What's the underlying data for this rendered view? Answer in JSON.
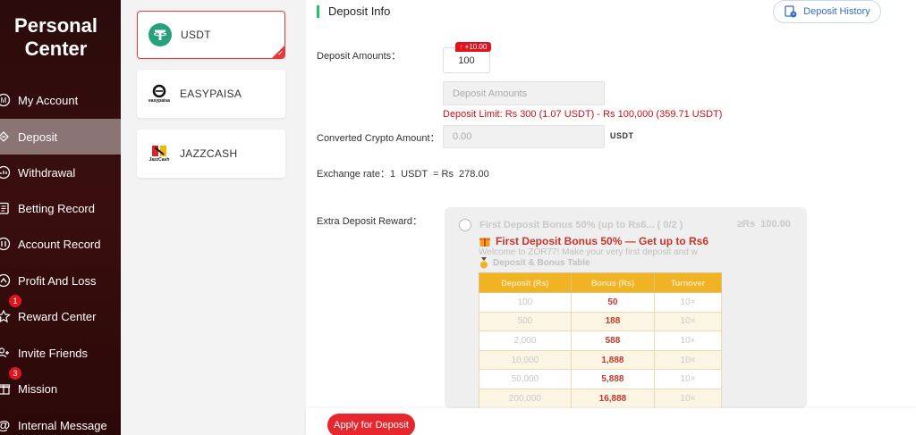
{
  "sidebar": {
    "title_line1": "Personal",
    "title_line2": "Center",
    "items": [
      {
        "label": "My Account",
        "icon": "account-icon"
      },
      {
        "label": "Deposit",
        "icon": "deposit-icon",
        "active": true
      },
      {
        "label": "Withdrawal",
        "icon": "withdrawal-icon"
      },
      {
        "label": "Betting Record",
        "icon": "betting-record-icon"
      },
      {
        "label": "Account Record",
        "icon": "account-record-icon"
      },
      {
        "label": "Profit And Loss",
        "icon": "profit-loss-icon"
      },
      {
        "label": "Reward Center",
        "icon": "reward-icon",
        "badge": "1"
      },
      {
        "label": "Invite Friends",
        "icon": "invite-icon"
      },
      {
        "label": "Mission",
        "icon": "gift-icon",
        "badge": "3"
      },
      {
        "label": "Internal Message",
        "icon": "at-icon"
      }
    ]
  },
  "methods": [
    {
      "label": "USDT",
      "selected": true
    },
    {
      "label": "EASYPAISA",
      "logo_text": "easypaisa"
    },
    {
      "label": "JAZZCASH",
      "logo_text": "JazzCash"
    }
  ],
  "deposit": {
    "section_title": "Deposit Info",
    "history_label": "Deposit History",
    "amounts_label": "Deposit Amounts：",
    "amount_value": "100",
    "amount_bonus_tag": "+10.00",
    "amount_bonus_arrow": "↑",
    "amount_placeholder": "Deposit Amounts",
    "limit_text": "Deposit Limit:  Rs  300 (1.07 USDT) - Rs  100,000 (359.71 USDT)",
    "crypto_label": "Converted Crypto Amount：",
    "crypto_value": "0.00",
    "crypto_unit": "USDT",
    "rate_label": "Exchange rate：",
    "rate_value": "1  USDT  = Rs  278.00",
    "reward_label": "Extra Deposit Reward："
  },
  "reward": {
    "heading": "First Deposit Bonus 50% (up to Rs6...  ( 0/2 )",
    "min": "≥Rs  100.00",
    "bonus_title": "First Deposit Bonus 50% — Get up to Rs6",
    "welcome": "Welcome to ZOR77! Make your very first deposit and w",
    "table_title": "Deposit & Bonus Table",
    "columns": [
      "Deposit (Rs)",
      "Bonus (Rs)",
      "Turnover"
    ],
    "rows": [
      [
        "100",
        "50",
        "10×"
      ],
      [
        "500",
        "188",
        "10×"
      ],
      [
        "2,000",
        "588",
        "10×"
      ],
      [
        "10,000",
        "1,888",
        "10×"
      ],
      [
        "50,000",
        "5,888",
        "10×"
      ],
      [
        "200,000",
        "16,888",
        "10×"
      ]
    ]
  },
  "footer": {
    "apply_label": "Apply for Deposit"
  },
  "colors": {
    "accent": "#e8262e",
    "section_bar": "#22c55e",
    "sidebar_bg": "#2a0b0b",
    "usdt": "#26a17b",
    "table_header": "#f0b324"
  }
}
